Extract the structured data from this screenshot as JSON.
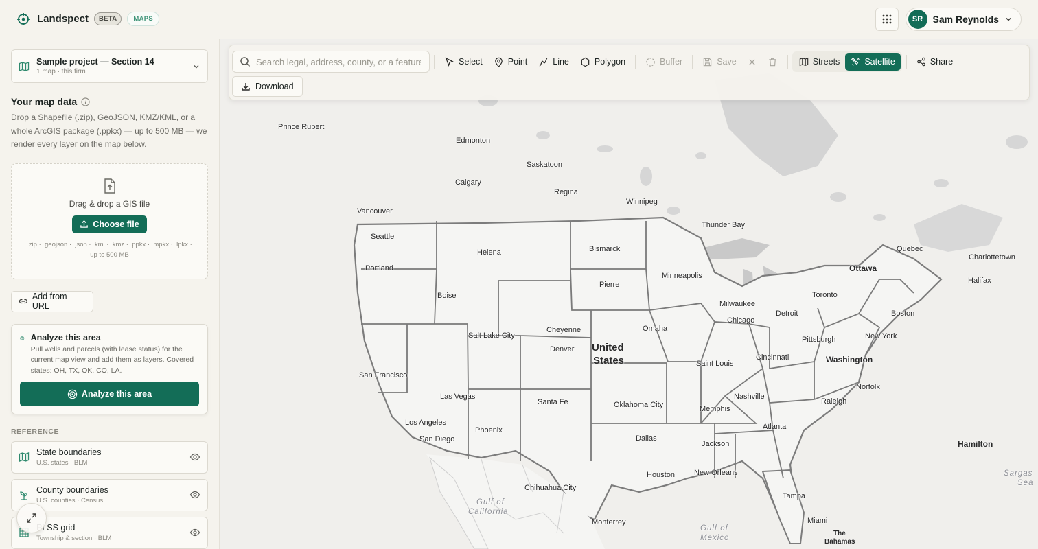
{
  "header": {
    "brand": "Landspect",
    "beta_badge": "BETA",
    "maps_badge": "MAPS",
    "user_initials": "SR",
    "user_name": "Sam Reynolds"
  },
  "sidebar": {
    "project_title": "Sample project — Section 14",
    "project_sub": "1 map · this firm",
    "map_data_title": "Your map data",
    "map_data_desc": "Drop a Shapefile (.zip), GeoJSON, KMZ/KML, or a whole ArcGIS package (.ppkx) — up to 500 MB — we render every layer on the map below.",
    "dropzone_text": "Drag & drop a GIS file",
    "choose_file": "Choose file",
    "formats": ".zip · .geojson · .json · .kml · .kmz · .ppkx · .mpkx · .lpkx · up to 500 MB",
    "add_url": "Add from URL",
    "analyze": {
      "title": "Analyze this area",
      "desc": "Pull wells and parcels (with lease status) for the current map view and add them as layers. Covered states: OH, TX, OK, CO, LA.",
      "button": "Analyze this area"
    },
    "reference_label": "REFERENCE",
    "reference_items": [
      {
        "title": "State boundaries",
        "sub": "U.S. states · BLM"
      },
      {
        "title": "County boundaries",
        "sub": "U.S. counties · Census"
      },
      {
        "title": "PLSS grid",
        "sub": "Township & section · BLM"
      }
    ]
  },
  "toolbar": {
    "search_placeholder": "Search legal, address, county, or a feature",
    "select": "Select",
    "point": "Point",
    "line": "Line",
    "polygon": "Polygon",
    "buffer": "Buffer",
    "save": "Save",
    "streets": "Streets",
    "satellite": "Satellite",
    "share": "Share",
    "download": "Download"
  },
  "map": {
    "labels": {
      "prince_rupert": "Prince Rupert",
      "edmonton": "Edmonton",
      "saskatoon": "Saskatoon",
      "calgary": "Calgary",
      "regina": "Regina",
      "winnipeg": "Winnipeg",
      "vancouver": "Vancouver",
      "thunder_bay": "Thunder Bay",
      "seattle": "Seattle",
      "helena": "Helena",
      "bismarck": "Bismarck",
      "quebec": "Quebec",
      "charlottetown": "Charlottetown",
      "portland": "Portland",
      "ottawa": "Ottawa",
      "halifax": "Halifax",
      "minneapolis": "Minneapolis",
      "pierre": "Pierre",
      "boise": "Boise",
      "toronto": "Toronto",
      "milwaukee": "Milwaukee",
      "boston": "Boston",
      "detroit": "Detroit",
      "chicago": "Chicago",
      "cheyenne": "Cheyenne",
      "omaha": "Omaha",
      "salt_lake_city": "Salt Lake City",
      "new_york": "New York",
      "pittsburgh": "Pittsburgh",
      "united": "United",
      "states": "States",
      "denver": "Denver",
      "cincinnati": "Cincinnati",
      "washington": "Washington",
      "saint_louis": "Saint Louis",
      "san_francisco": "San Francisco",
      "norfolk": "Norfolk",
      "nashville": "Nashville",
      "las_vegas": "Las Vegas",
      "raleigh": "Raleigh",
      "santa_fe": "Santa Fe",
      "oklahoma_city": "Oklahoma City",
      "memphis": "Memphis",
      "los_angeles": "Los Angeles",
      "phoenix": "Phoenix",
      "atlanta": "Atlanta",
      "san_diego": "San Diego",
      "dallas": "Dallas",
      "jackson": "Jackson",
      "hamilton": "Hamilton",
      "houston": "Houston",
      "new_orleans": "New Orleans",
      "sargas": "Sargas",
      "sea": "Sea",
      "chihuahua_city": "Chihuahua City",
      "tampa": "Tampa",
      "gulf_of": "Gulf of",
      "california": "California",
      "monterrey": "Monterrey",
      "miami": "Miami",
      "gulf_of_2": "Gulf of",
      "mexico": "Mexico",
      "the": "The",
      "bahamas": "Bahamas"
    }
  },
  "colors": {
    "primary": "#136d57",
    "map_land": "#f3f3f1",
    "map_water": "#d4d4d4",
    "map_border": "#6f6f6f"
  }
}
